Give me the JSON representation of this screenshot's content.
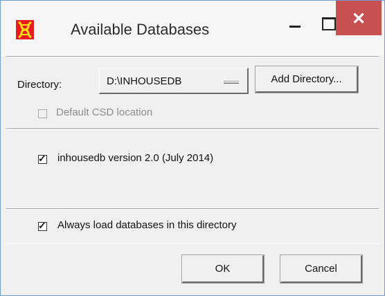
{
  "window": {
    "title": "Available Databases",
    "minimize_glyph": "–",
    "maximize_glyph": "□",
    "close_glyph": "✕"
  },
  "directory": {
    "label": "Directory:",
    "selected_value": "D:\\INHOUSEDB",
    "add_button_label": "Add Directory..."
  },
  "default_csd": {
    "label": "Default CSD location",
    "checked": false,
    "disabled": true
  },
  "databases": [
    {
      "label": "inhousedb version 2.0 (July 2014)",
      "checked": true
    }
  ],
  "always_load": {
    "label": "Always load databases in this directory",
    "checked": true
  },
  "buttons": {
    "ok_label": "OK",
    "cancel_label": "Cancel"
  },
  "colors": {
    "close_button": "#c75050",
    "dialog_background": "#f0f0f0",
    "app_icon_red": "#e81c1c",
    "app_icon_yellow": "#f7e017"
  }
}
